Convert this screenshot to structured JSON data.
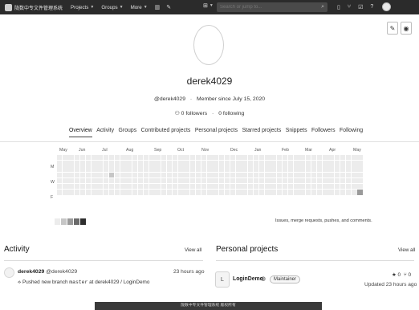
{
  "navbar": {
    "brand": "陇数中专文件管理系统",
    "links": [
      {
        "label": "Projects",
        "has_dropdown": true
      },
      {
        "label": "Groups",
        "has_dropdown": true
      },
      {
        "label": "More",
        "has_dropdown": true
      }
    ],
    "search_placeholder": "Search or jump to...",
    "accent_color": "#2b2b2b"
  },
  "profile": {
    "username": "derek4029",
    "handle": "@derek4029",
    "separator": "·",
    "member_since": "Member since July 15, 2020",
    "followers": "0 followers",
    "following": "0 following"
  },
  "tabs": [
    {
      "label": "Overview",
      "active": true
    },
    {
      "label": "Activity"
    },
    {
      "label": "Groups"
    },
    {
      "label": "Contributed projects"
    },
    {
      "label": "Personal projects"
    },
    {
      "label": "Starred projects"
    },
    {
      "label": "Snippets"
    },
    {
      "label": "Followers"
    },
    {
      "label": "Following"
    }
  ],
  "calendar": {
    "months": [
      "May",
      "Jun",
      "Jul",
      "Aug",
      "Sep",
      "Oct",
      "Nov",
      "Dec",
      "Jan",
      "Feb",
      "Mar",
      "Apr",
      "May"
    ],
    "day_labels": [
      "M",
      "W",
      "F"
    ],
    "legend_text": "Issues, merge requests, pushes, and comments.",
    "legend_colors": [
      "#ececec",
      "#c6c6c6",
      "#9a9a9a",
      "#6a6a6a",
      "#2e2e2e"
    ],
    "active_cells": [
      {
        "week": 9,
        "day": 3,
        "level": 1
      },
      {
        "week": 52,
        "day": 6,
        "level": 2
      }
    ]
  },
  "activity": {
    "title": "Activity",
    "view_all": "View all",
    "events": [
      {
        "user_name": "derek4029",
        "user_handle": "@derek4029",
        "time": "23 hours ago",
        "action_prefix": "Pushed new branch",
        "branch": "master",
        "action_suffix": "at derek4029 / LoginDemo"
      }
    ]
  },
  "personal_projects": {
    "title": "Personal projects",
    "view_all": "View all",
    "projects": [
      {
        "initial": "L",
        "name": "LoginDemo",
        "role": "Maintainer",
        "stars": "0",
        "forks": "0",
        "updated": "Updated 23 hours ago"
      }
    ]
  },
  "footer": {
    "text": "陇数中专文件管理系统 版权所有"
  }
}
